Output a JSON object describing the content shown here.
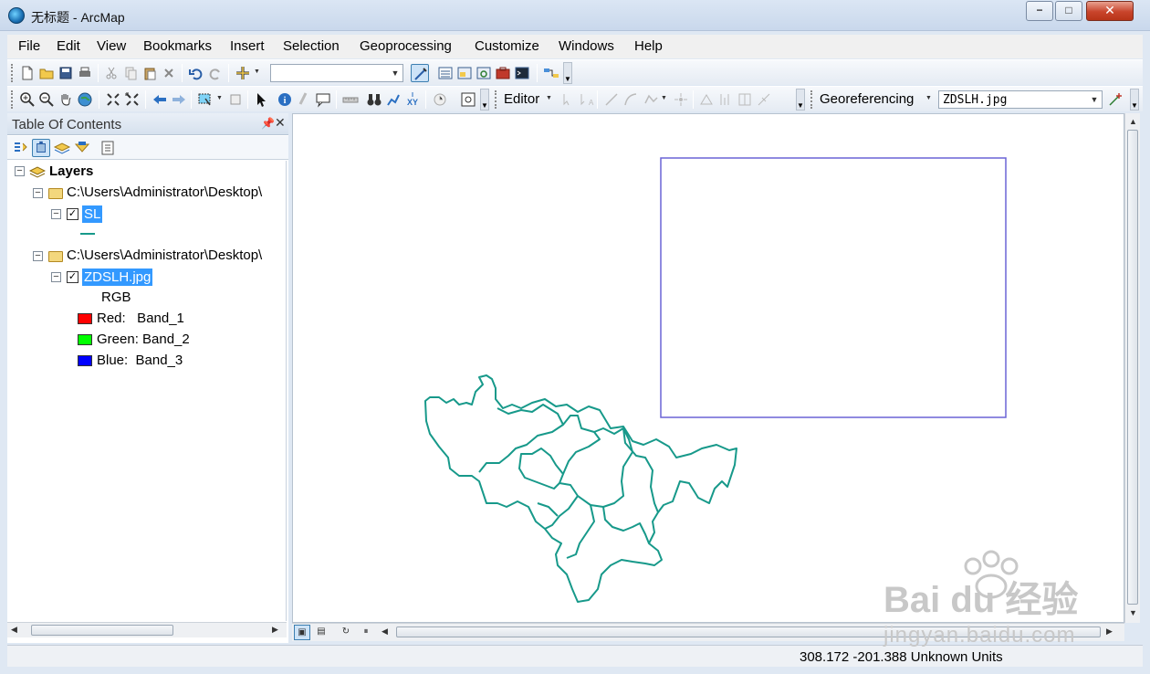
{
  "window": {
    "title": "无标题 - ArcMap",
    "minimize": "−",
    "maximize": "□",
    "close": "✕"
  },
  "menu": [
    "File",
    "Edit",
    "View",
    "Bookmarks",
    "Insert",
    "Selection",
    "Geoprocessing",
    "Customize",
    "Windows",
    "Help"
  ],
  "toolbar": {
    "scale_value": "",
    "editor_label": "Editor",
    "georef_label": "Georeferencing",
    "georef_layer": "ZDSLH.jpg"
  },
  "toc": {
    "title": "Table Of Contents",
    "root": "Layers",
    "groups": [
      {
        "path": "C:\\Users\\Administrator\\Desktop\\",
        "layer": "SL"
      },
      {
        "path": "C:\\Users\\Administrator\\Desktop\\",
        "layer": "ZDSLH.jpg",
        "legend_header": "RGB",
        "bands": [
          {
            "label": "Red:   Band_1",
            "color": "#ff0000"
          },
          {
            "label": "Green: Band_2",
            "color": "#00ff00"
          },
          {
            "label": "Blue:  Band_3",
            "color": "#0000ff"
          }
        ]
      }
    ]
  },
  "map": {
    "feature_color": "#17998a",
    "extent_color": "#6a63d6"
  },
  "status": {
    "coords": "308.172  -201.388 Unknown Units"
  },
  "watermark": {
    "brand": "Bai du 经验",
    "url": "jingyan.baidu.com"
  }
}
